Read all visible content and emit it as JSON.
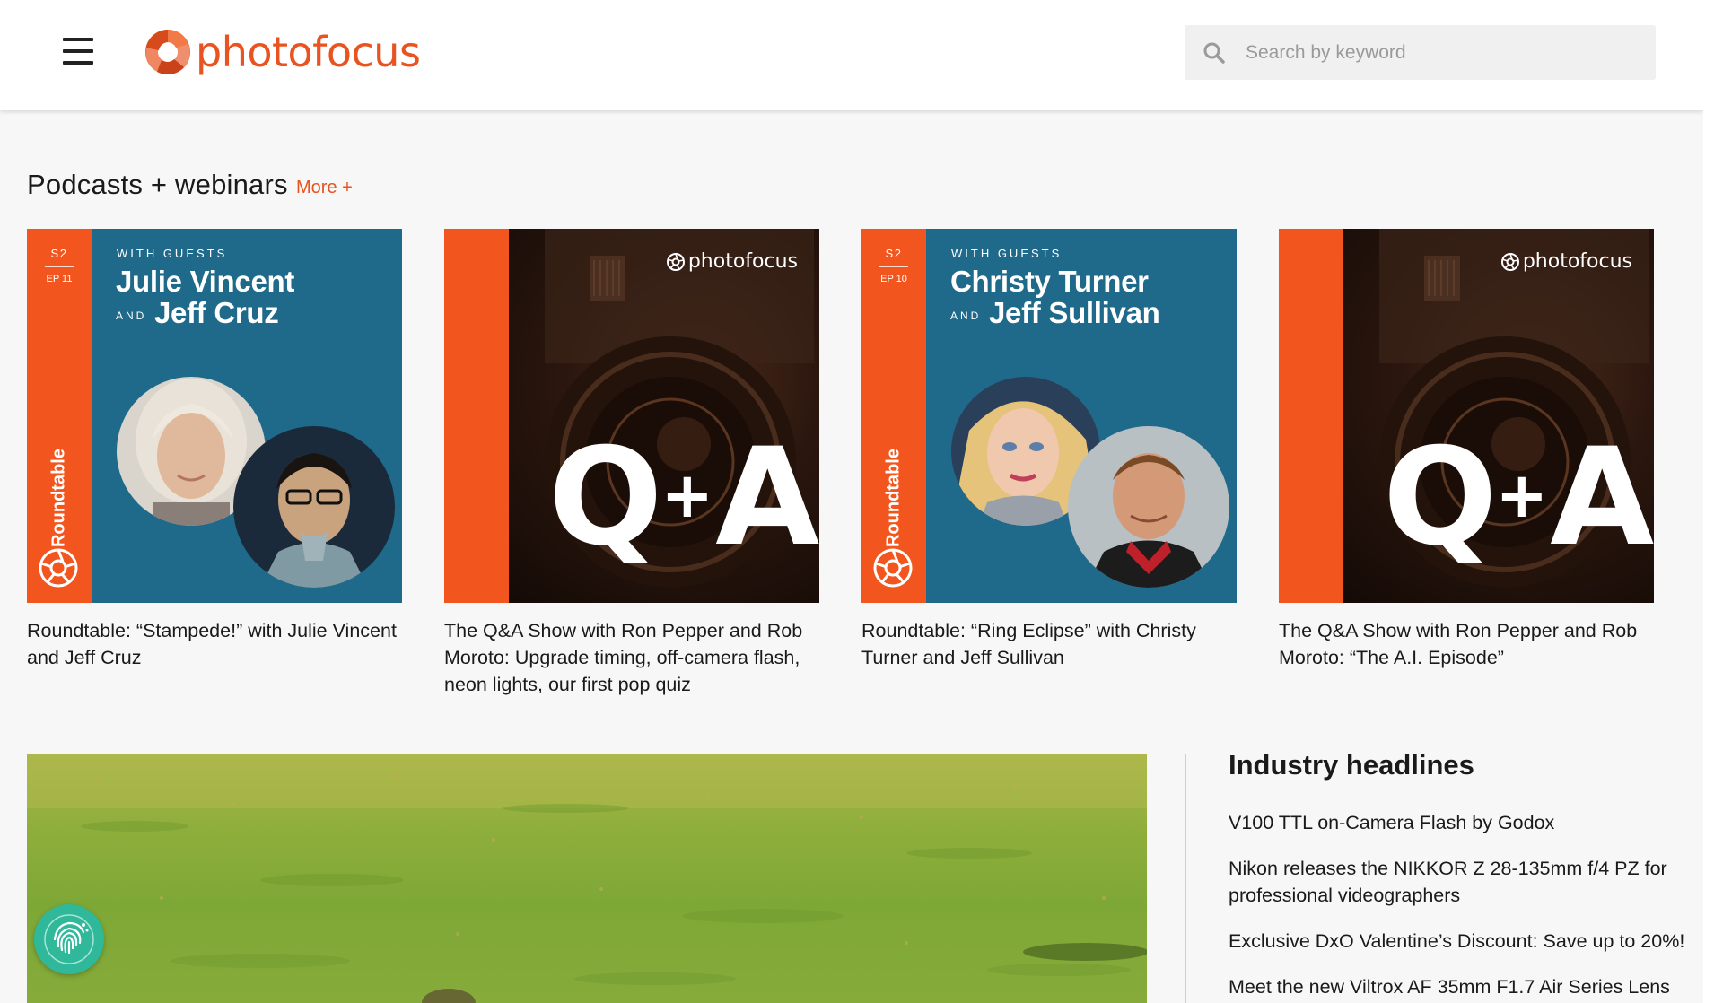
{
  "header": {
    "logo_text": "photofocus",
    "search_placeholder": "Search by keyword"
  },
  "podcasts": {
    "title": "Podcasts + webinars",
    "more_label": "More  +",
    "cards": [
      {
        "kind": "roundtable",
        "season": "S2",
        "episode": "EP 11",
        "vertical_label": "Roundtable",
        "with_guests": "WITH GUESTS",
        "guest1": "Julie Vincent",
        "and": "AND",
        "guest2": "Jeff Cruz",
        "title": "Roundtable: “Stampede!” with Julie Vincent and Jeff Cruz"
      },
      {
        "kind": "qa",
        "brand": "photofocus",
        "qa_q": "Q",
        "qa_plus": "+",
        "qa_a": "A",
        "title": "The Q&A Show with Ron Pepper and Rob Moroto: Upgrade timing, off-camera flash, neon lights, our first pop quiz"
      },
      {
        "kind": "roundtable",
        "season": "S2",
        "episode": "EP 10",
        "vertical_label": "Roundtable",
        "with_guests": "WITH GUESTS",
        "guest1": "Christy Turner",
        "and": "AND",
        "guest2": "Jeff Sullivan",
        "title": "Roundtable: “Ring Eclipse” with Christy Turner and Jeff Sullivan"
      },
      {
        "kind": "qa",
        "brand": "photofocus",
        "qa_q": "Q",
        "qa_plus": "+",
        "qa_a": "A",
        "title": "The Q&A Show with Ron Pepper and Rob Moroto: “The A.I. Episode”"
      }
    ]
  },
  "headlines": {
    "title": "Industry headlines",
    "items": [
      "V100 TTL on-Camera Flash by Godox",
      "Nikon releases the NIKKOR Z 28-135mm f/4 PZ for professional videographers",
      "Exclusive DxO Valentine’s Discount: Save up to 20%!",
      "Meet the new Viltrox AF 35mm F1.7 Air Series Lens"
    ]
  },
  "colors": {
    "brand_orange": "#e8531f",
    "roundtable_blue": "#1f6a8a",
    "badge_green": "#2fb89a"
  },
  "icons": {
    "menu": "hamburger-menu-icon",
    "search": "search-icon",
    "logo": "aperture-logo-icon",
    "badge": "fingerprint-icon"
  }
}
